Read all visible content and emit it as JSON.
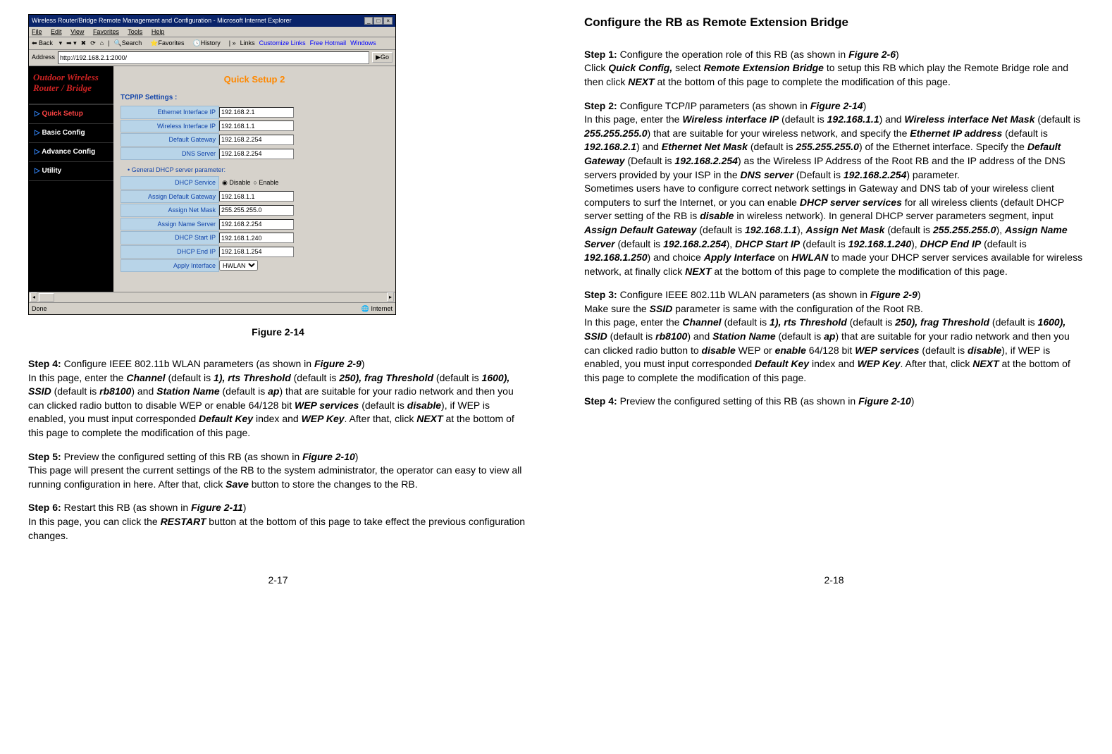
{
  "left_page": {
    "figure_caption": "Figure 2-14",
    "page_num": "2-17",
    "browser": {
      "title": "Wireless Router/Bridge Remote Management and Configuration - Microsoft Internet Explorer",
      "menus": [
        "File",
        "Edit",
        "View",
        "Favorites",
        "Tools",
        "Help"
      ],
      "toolbar": [
        "Back",
        "Search",
        "Favorites",
        "History"
      ],
      "links_label": "Links",
      "link1": "Customize Links",
      "link2": "Free Hotmail",
      "link3": "Windows",
      "address_label": "Address",
      "address_value": "http://192.168.2.1:2000/",
      "go": "Go",
      "status_done": "Done",
      "status_zone": "Internet"
    },
    "app": {
      "brand1": "Outdoor Wireless",
      "brand2": "Router / Bridge",
      "nav": [
        "Quick Setup",
        "Basic Config",
        "Advance Config",
        "Utility"
      ],
      "page_title": "Quick Setup 2",
      "section1": "TCP/IP Settings :",
      "rows1": [
        {
          "label": "Ethernet Interface IP",
          "value": "192.168.2.1"
        },
        {
          "label": "Wireless Interface IP",
          "value": "192.168.1.1"
        },
        {
          "label": "Default Gateway",
          "value": "192.168.2.254"
        },
        {
          "label": "DNS Server",
          "value": "192.168.2.254"
        }
      ],
      "general_hdr": "• General DHCP server parameter:",
      "dhcp_row_label": "DHCP Service",
      "dhcp_disable": "Disable",
      "dhcp_enable": "Enable",
      "rows2": [
        {
          "label": "Assign Default Gateway",
          "value": "192.168.1.1"
        },
        {
          "label": "Assign Net Mask",
          "value": "255.255.255.0"
        },
        {
          "label": "Assign Name Server",
          "value": "192.168.2.254"
        },
        {
          "label": "DHCP Start IP",
          "value": "192.168.1.240"
        },
        {
          "label": "DHCP End IP",
          "value": "192.168.1.254"
        }
      ],
      "apply_row_label": "Apply Interface",
      "apply_value": "HWLAN"
    },
    "step4_label": "Step 4:",
    "step4_intro": " Configure IEEE 802.11b WLAN parameters (as shown in ",
    "step4_fig": "Figure 2-9",
    "step4_p1a": "In this page, enter the ",
    "step4_channel": "Channel",
    "step4_p1b": " (default is ",
    "step4_1": "1",
    "step4_rts": "), rts Threshold",
    "step4_250": "250",
    "step4_frag": "), frag Threshold",
    "step4_1600": "1600",
    "step4_ssid": "), SSID",
    "step4_rb8100": "rb8100",
    "step4_and": ") and ",
    "step4_station": "Station Name",
    "step4_ap": "ap",
    "step4_c": ") that are suitable for your radio network and then you can clicked radio button to disable WEP or enable 64/128 bit ",
    "step4_wep": "WEP services",
    "step4_d": " (default is ",
    "step4_disable": "disable",
    "step4_e": "), if WEP is enabled, you must input corresponded ",
    "step4_dk": "Default Key",
    "step4_f": " index and ",
    "step4_wk": "WEP Key",
    "step4_g": ". After that, click ",
    "step4_next": "NEXT",
    "step4_h": " at the bottom of this page to complete the modification of this page.",
    "step5_label": "Step 5:",
    "step5_intro": " Preview the configured setting of this RB (as shown in ",
    "step5_fig": "Figure 2-10",
    "step5_body": "This page will present the current settings of the RB to the system administrator, the operator can easy to view all running configuration in here. After that, click ",
    "step5_save": "Save",
    "step5_end": " button to store the changes to the RB.",
    "step6_label": "Step 6:",
    "step6_intro": " Restart this RB (as shown in ",
    "step6_fig": "Figure 2-11",
    "step6_body_a": "In this page, you can click the ",
    "step6_restart": "RESTART",
    "step6_body_b": " button at the bottom of this page to take effect the previous configuration changes."
  },
  "right_page": {
    "page_num": "2-18",
    "title": "Configure the RB as Remote Extension Bridge",
    "s1_label": "Step 1:",
    "s1_a": " Configure the operation role of this RB (as shown in ",
    "s1_fig": "Figure 2-6",
    "s1_b": "Click ",
    "s1_qc": "Quick Config,",
    "s1_c": " select ",
    "s1_reb": "Remote Extension Bridge",
    "s1_d": " to setup this RB which play the Remote Bridge role and then click ",
    "s1_next": "NEXT",
    "s1_e": " at the bottom of this page to complete the modification of this page.",
    "s2_label": "Step 2:",
    "s2_a": " Configure TCP/IP parameters (as shown in ",
    "s2_fig": "Figure 2-14",
    "s2_b": "In this page, enter the ",
    "s2_wip": "Wireless interface IP",
    "s2_def": " (default is ",
    "s2_v_wip": "192.168.1.1",
    "s2_and": ") and ",
    "s2_wnm": "Wireless interface Net Mask",
    "s2_v_wnm": "255.255.255.0",
    "s2_c": ") that are suitable for your wireless network, and specify the ",
    "s2_eip": "Ethernet IP address",
    "s2_v_eip": "192.168.2.1",
    "s2_enm": "Ethernet Net Mask",
    "s2_v_enm": "255.255.255.0",
    "s2_d": ") of the Ethernet interface. Specify the ",
    "s2_dg": "Default Gateway",
    "s2_def2": " (Default is ",
    "s2_v_dg": "192.168.2.254",
    "s2_e": ") as the Wireless IP Address of the Root RB and the IP address of the DNS servers provided by your ISP in the ",
    "s2_dns": "DNS server",
    "s2_v_dns": "192.168.2.254",
    "s2_f": ") parameter.",
    "s2_p2a": "Sometimes users have to configure correct network settings in Gateway and DNS tab of your wireless client computers to surf the Internet, or you can enable ",
    "s2_dss": "DHCP server services",
    "s2_p2b": " for all wireless clients (default DHCP server setting of the RB is ",
    "s2_dis": "disable",
    "s2_p2c": " in wireless network). In general DHCP server parameters segment, input ",
    "s2_adg": "Assign Default Gateway",
    "s2_v_adg": "192.168.1.1",
    "s2_anm": "Assign Net Mask",
    "s2_v_anm": "255.255.255.0",
    "s2_ans": "Assign Name Server",
    "s2_v_ans": "192.168.2.254",
    "s2_dsi": "DHCP Start IP",
    "s2_v_dsi": "192.168.1.240",
    "s2_dei": "DHCP End IP",
    "s2_v_dei": "192.168.1.250",
    "s2_choice": ") and choice ",
    "s2_ai": "Apply Interface",
    "s2_on": " on ",
    "s2_hw": "HWLAN",
    "s2_end": " to made your DHCP server services available for wireless network, at finally click ",
    "s2_next": "NEXT",
    "s2_end2": " at the bottom of this page to complete the modification of this page.",
    "s3_label": "Step 3:",
    "s3_a": " Configure IEEE 802.11b WLAN parameters (as shown in ",
    "s3_fig": "Figure 2-9",
    "s3_b": "Make sure the ",
    "s3_ssid": "SSID",
    "s3_c": " parameter is same with the configuration of the Root RB.",
    "s3_p2a": "In this page, enter the ",
    "s3_ch": "Channel",
    "s3_1": "1",
    "s3_rts": "), rts Threshold",
    "s3_250": "250",
    "s3_frag": "), frag Threshold",
    "s3_1600": "1600",
    "s3_ssid2": "), SSID",
    "s3_rb": "rb8100",
    "s3_sn": "Station Name",
    "s3_ap": "ap",
    "s3_d": ") that are suitable for your radio network and then you can clicked radio button to ",
    "s3_dis": "disable",
    "s3_e": " WEP or ",
    "s3_en": "enable",
    "s3_f": " 64/128 bit ",
    "s3_wep": "WEP services",
    "s3_g": "), if WEP is enabled, you must input corresponded ",
    "s3_dk": "Default Key",
    "s3_h": " index and ",
    "s3_wk": "WEP Key",
    "s3_i": ". After that, click ",
    "s3_next": "NEXT",
    "s3_j": " at the bottom of this page to complete the modification of this page.",
    "s4_label": "Step 4:",
    "s4_a": " Preview the configured setting of this RB (as shown in ",
    "s4_fig": "Figure 2-10"
  }
}
